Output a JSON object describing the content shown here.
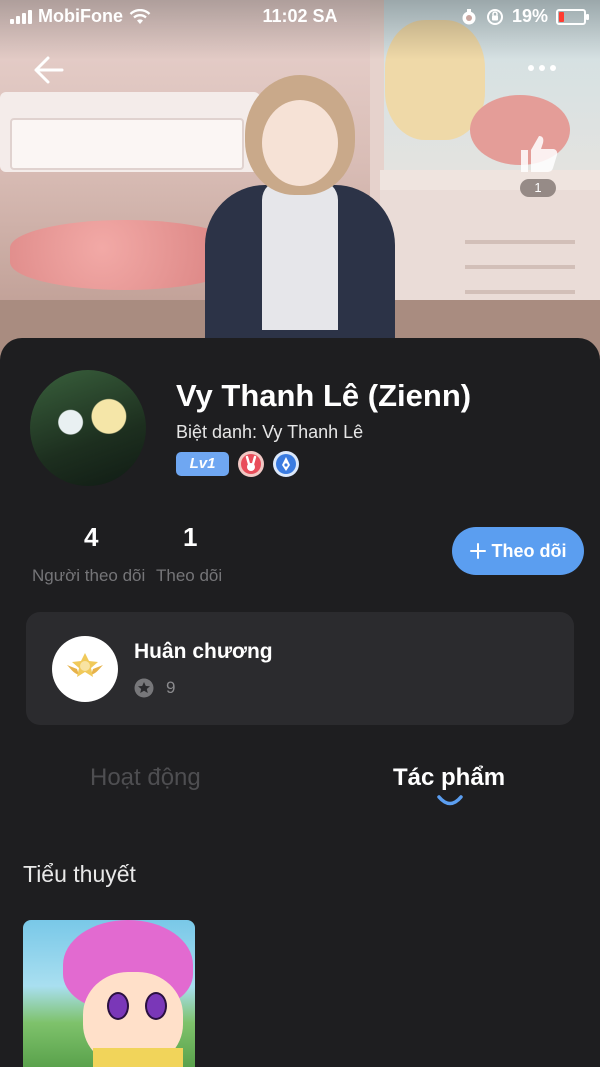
{
  "status_bar": {
    "carrier": "MobiFone",
    "time": "11:02 SA",
    "battery": "19%"
  },
  "header": {
    "like_count": "1"
  },
  "profile": {
    "name": "Vy Thanh Lê (Zienn)",
    "nickname": "Biệt danh: Vy Thanh Lê",
    "level_badge": "Lv1"
  },
  "stats": {
    "followers_count": "4",
    "followers_label": "Người theo dõi",
    "following_count": "1",
    "following_label": "Theo dõi"
  },
  "follow_button": {
    "label": "Theo dõi"
  },
  "medals": {
    "title": "Huân chương",
    "count": "9"
  },
  "tabs": [
    {
      "label": "Hoạt động",
      "active": false
    },
    {
      "label": "Tác phẩm",
      "active": true
    }
  ],
  "works_section": {
    "title": "Tiểu thuyết"
  },
  "colors": {
    "accent": "#5b9ef0",
    "background": "#1e1e20",
    "card": "#2b2b2e"
  }
}
